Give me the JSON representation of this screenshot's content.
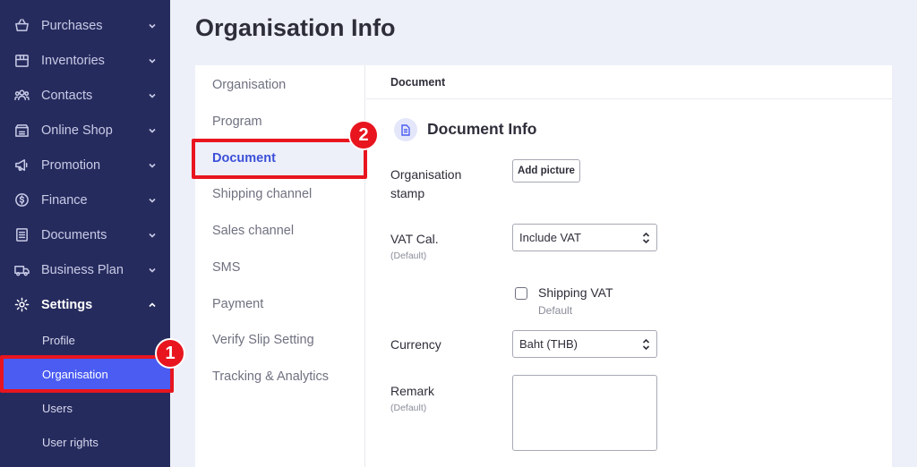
{
  "sidebar": {
    "items": [
      {
        "label": "Purchases",
        "icon": "basket-icon"
      },
      {
        "label": "Inventories",
        "icon": "box-icon"
      },
      {
        "label": "Contacts",
        "icon": "people-icon"
      },
      {
        "label": "Online Shop",
        "icon": "shop-icon"
      },
      {
        "label": "Promotion",
        "icon": "megaphone-icon"
      },
      {
        "label": "Finance",
        "icon": "dollar-icon"
      },
      {
        "label": "Documents",
        "icon": "document-icon"
      },
      {
        "label": "Business Plan",
        "icon": "truck-icon"
      },
      {
        "label": "Settings",
        "icon": "gear-icon"
      }
    ],
    "sub_items": [
      {
        "label": "Profile"
      },
      {
        "label": "Organisation"
      },
      {
        "label": "Users"
      },
      {
        "label": "User rights"
      }
    ]
  },
  "page": {
    "title": "Organisation Info"
  },
  "tabs": [
    {
      "label": "Organisation"
    },
    {
      "label": "Program"
    },
    {
      "label": "Document"
    },
    {
      "label": "Shipping channel"
    },
    {
      "label": "Sales channel"
    },
    {
      "label": "SMS"
    },
    {
      "label": "Payment"
    },
    {
      "label": "Verify Slip Setting"
    },
    {
      "label": "Tracking & Analytics"
    }
  ],
  "content": {
    "header": "Document",
    "section_title": "Document Info",
    "stamp_label_1": "Organisation",
    "stamp_label_2": "stamp",
    "add_picture": "Add picture",
    "vat_label": "VAT Cal.",
    "vat_sub": "(Default)",
    "vat_value": "Include VAT",
    "shipping_vat_label": "Shipping VAT",
    "shipping_vat_sub": "Default",
    "currency_label": "Currency",
    "currency_value": "Baht (THB)",
    "remark_label": "Remark",
    "remark_sub": "(Default)"
  },
  "annotations": {
    "badge_1": "1",
    "badge_2": "2"
  },
  "colors": {
    "sidebar_bg": "#262b5e",
    "accent": "#4a5cf2",
    "highlight": "#e8151f",
    "page_bg": "#eef0f9"
  }
}
